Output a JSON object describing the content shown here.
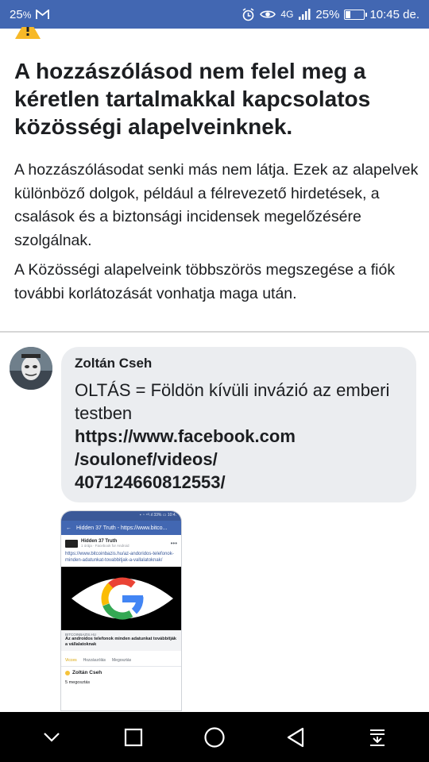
{
  "status_bar": {
    "left_text": "25",
    "left_unit": "%",
    "network": "4G",
    "battery_percent": "25%",
    "battery_level": 0.25,
    "time": "10:45 de."
  },
  "notice": {
    "title": "A hozzászólásod nem felel meg a kéretlen tartalmakkal kapcsolatos közösségi alapelveinknek.",
    "paragraph1": "A hozzászólásodat senki más nem látja. Ezek az alapelvek különböző dolgok, például a félrevezető hirdetések, a csalások és a biztonsági incidensek megelőzésére szolgálnak.",
    "paragraph2": "A Közösségi alapelveink többszörös megszegése a fiók további korlátozását vonhatja maga után."
  },
  "comment": {
    "author": "Zoltán Cseh",
    "text": "OLTÁS = Földön kívüli invázió az emberi testben",
    "link_line1": "https://www.facebook.com",
    "link_line2": "/soulonef/videos/",
    "link_line3": "407124660812553/"
  },
  "attachment": {
    "nav_title": "Hidden 37 Truth - https://www.bitco...",
    "page_name": "Hidden 37 Truth",
    "page_sub": "1 órája · Facebook for Android",
    "url_text": "https://www.bitcoinbazis.hu/az-andoridos-telefonok-minden-adatunkat-tovabbitjak-a-vallalatoknak/",
    "domain": "BITCOINBAZIS.HU",
    "headline": "Az androidos telefonok minden adatunkat továbbítják a vállalatoknak",
    "action_like": "Vicces",
    "action_comment": "Hozzászólás",
    "action_share": "Megosztás",
    "user": "Zoltán Cseh",
    "shares": "5 megosztás"
  },
  "colors": {
    "facebook_blue": "#4267b2",
    "bubble_gray": "#ebedf0",
    "warning_yellow": "#f7b928"
  }
}
